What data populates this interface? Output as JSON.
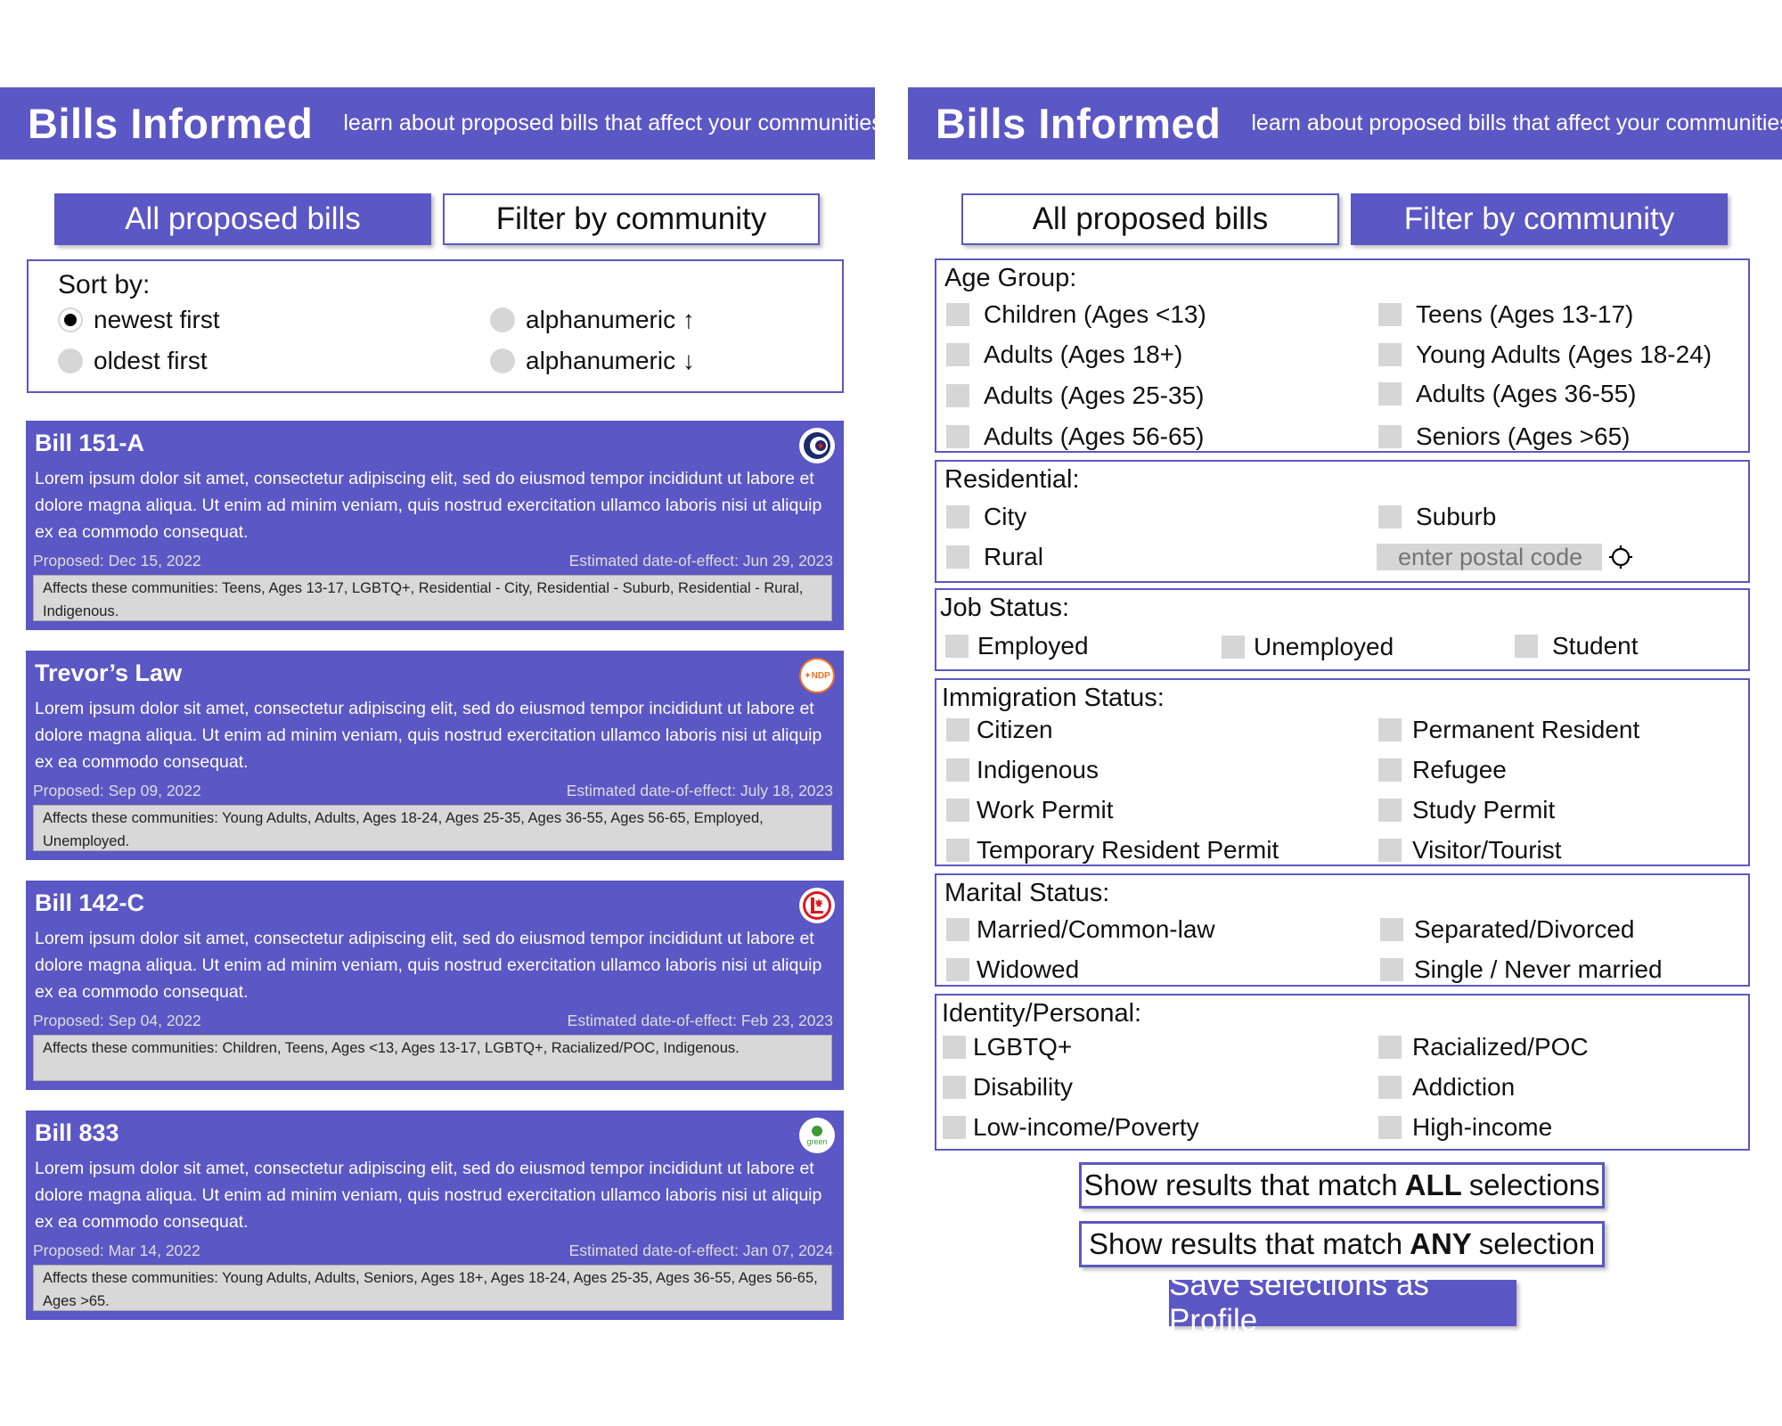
{
  "app": {
    "title": "Bills Informed",
    "tagline": "learn about proposed bills that affect your communities"
  },
  "tabs": {
    "all": "All proposed bills",
    "filter": "Filter by community"
  },
  "sort": {
    "label": "Sort by:",
    "options": [
      "newest first",
      "oldest first",
      "alphanumeric ↑",
      "alphanumeric ↓"
    ],
    "selected": "newest first"
  },
  "bills": [
    {
      "title": "Bill 151-A",
      "body": "Lorem ipsum dolor sit amet, consectetur adipiscing elit, sed do eiusmod tempor incididunt ut labore et dolore magna aliqua. Ut enim ad minim veniam, quis nostrud exercitation ullamco laboris nisi ut aliquip ex ea commodo consequat.",
      "proposed": "Proposed: Dec 15, 2022",
      "effect": "Estimated date-of-effect: Jun 29, 2023",
      "affects": "Affects these communities: Teens, Ages 13-17, LGBTQ+, Residential - City, Residential - Suburb, Residential - Rural, Indigenous.",
      "party_icon": "conservative-party-icon",
      "party_color": "#1a2a6c"
    },
    {
      "title": "Trevor’s Law",
      "body": "Lorem ipsum dolor sit amet, consectetur adipiscing elit, sed do eiusmod tempor incididunt ut labore et dolore magna aliqua. Ut enim ad minim veniam, quis nostrud exercitation ullamco laboris nisi ut aliquip ex ea commodo consequat.",
      "proposed": "Proposed: Sep 09, 2022",
      "effect": "Estimated date-of-effect: July 18, 2023",
      "affects": "Affects these communities: Young Adults, Adults, Ages 18-24, Ages 25-35, Ages 36-55, Ages 56-65, Employed, Unemployed.",
      "party_icon": "ndp-party-icon",
      "party_label": "✦NDP",
      "party_color": "#f37021"
    },
    {
      "title": "Bill 142-C",
      "body": "Lorem ipsum dolor sit amet, consectetur adipiscing elit, sed do eiusmod tempor incididunt ut labore et dolore magna aliqua. Ut enim ad minim veniam, quis nostrud exercitation ullamco laboris nisi ut aliquip ex ea commodo consequat.",
      "proposed": "Proposed: Sep 04, 2022",
      "effect": "Estimated date-of-effect: Feb 23, 2023",
      "affects": "Affects these communities: Children, Teens, Ages <13, Ages 13-17, LGBTQ+, Racialized/POC, Indigenous.",
      "party_icon": "liberal-party-icon",
      "party_color": "#d71920"
    },
    {
      "title": "Bill 833",
      "body": "Lorem ipsum dolor sit amet, consectetur adipiscing elit, sed do eiusmod tempor incididunt ut labore et dolore magna aliqua. Ut enim ad minim veniam, quis nostrud exercitation ullamco laboris nisi ut aliquip ex ea commodo consequat.",
      "proposed": "Proposed: Mar 14, 2022",
      "effect": "Estimated date-of-effect: Jan 07, 2024",
      "affects": "Affects these communities: Young Adults, Adults, Seniors, Ages 18+, Ages 18-24, Ages 25-35, Ages 36-55, Ages 56-65, Ages >65.",
      "party_icon": "green-party-icon",
      "party_label": "green",
      "party_color": "#3d9b35"
    }
  ],
  "filters": {
    "age": {
      "label": "Age Group:",
      "options": [
        "Children (Ages <13)",
        "Teens (Ages 13-17)",
        "Adults (Ages 18+)",
        "Young Adults (Ages 18-24)",
        "Adults (Ages 25-35)",
        "Adults (Ages 36-55)",
        "Adults (Ages 56-65)",
        "Seniors (Ages >65)"
      ]
    },
    "residential": {
      "label": "Residential:",
      "options": [
        "City",
        "Suburb",
        "Rural"
      ],
      "postal_placeholder": "enter postal code"
    },
    "job": {
      "label": "Job Status:",
      "options": [
        "Employed",
        "Unemployed",
        "Student"
      ]
    },
    "immigration": {
      "label": "Immigration Status:",
      "options": [
        "Citizen",
        "Permanent Resident",
        "Indigenous",
        "Refugee",
        "Work Permit",
        "Study Permit",
        "Temporary Resident Permit",
        "Visitor/Tourist"
      ]
    },
    "marital": {
      "label": "Marital Status:",
      "options": [
        "Married/Common-law",
        "Separated/Divorced",
        "Widowed",
        "Single / Never married"
      ]
    },
    "identity": {
      "label": "Identity/Personal:",
      "options": [
        "LGBTQ+",
        "Racialized/POC",
        "Disability",
        "Addiction",
        "Low-income/Poverty",
        "High-income"
      ]
    }
  },
  "actions": {
    "match_all": {
      "prefix": "Show results that match",
      "bold": "ALL",
      "suffix": "selections"
    },
    "match_any": {
      "prefix": "Show results that match",
      "bold": "ANY",
      "suffix": "selection"
    },
    "save": "Save selections as Profile"
  },
  "colors": {
    "accent": "#5b57c4",
    "checkbox": "#d6d6d6",
    "affects_bg": "#d8d8d8"
  }
}
